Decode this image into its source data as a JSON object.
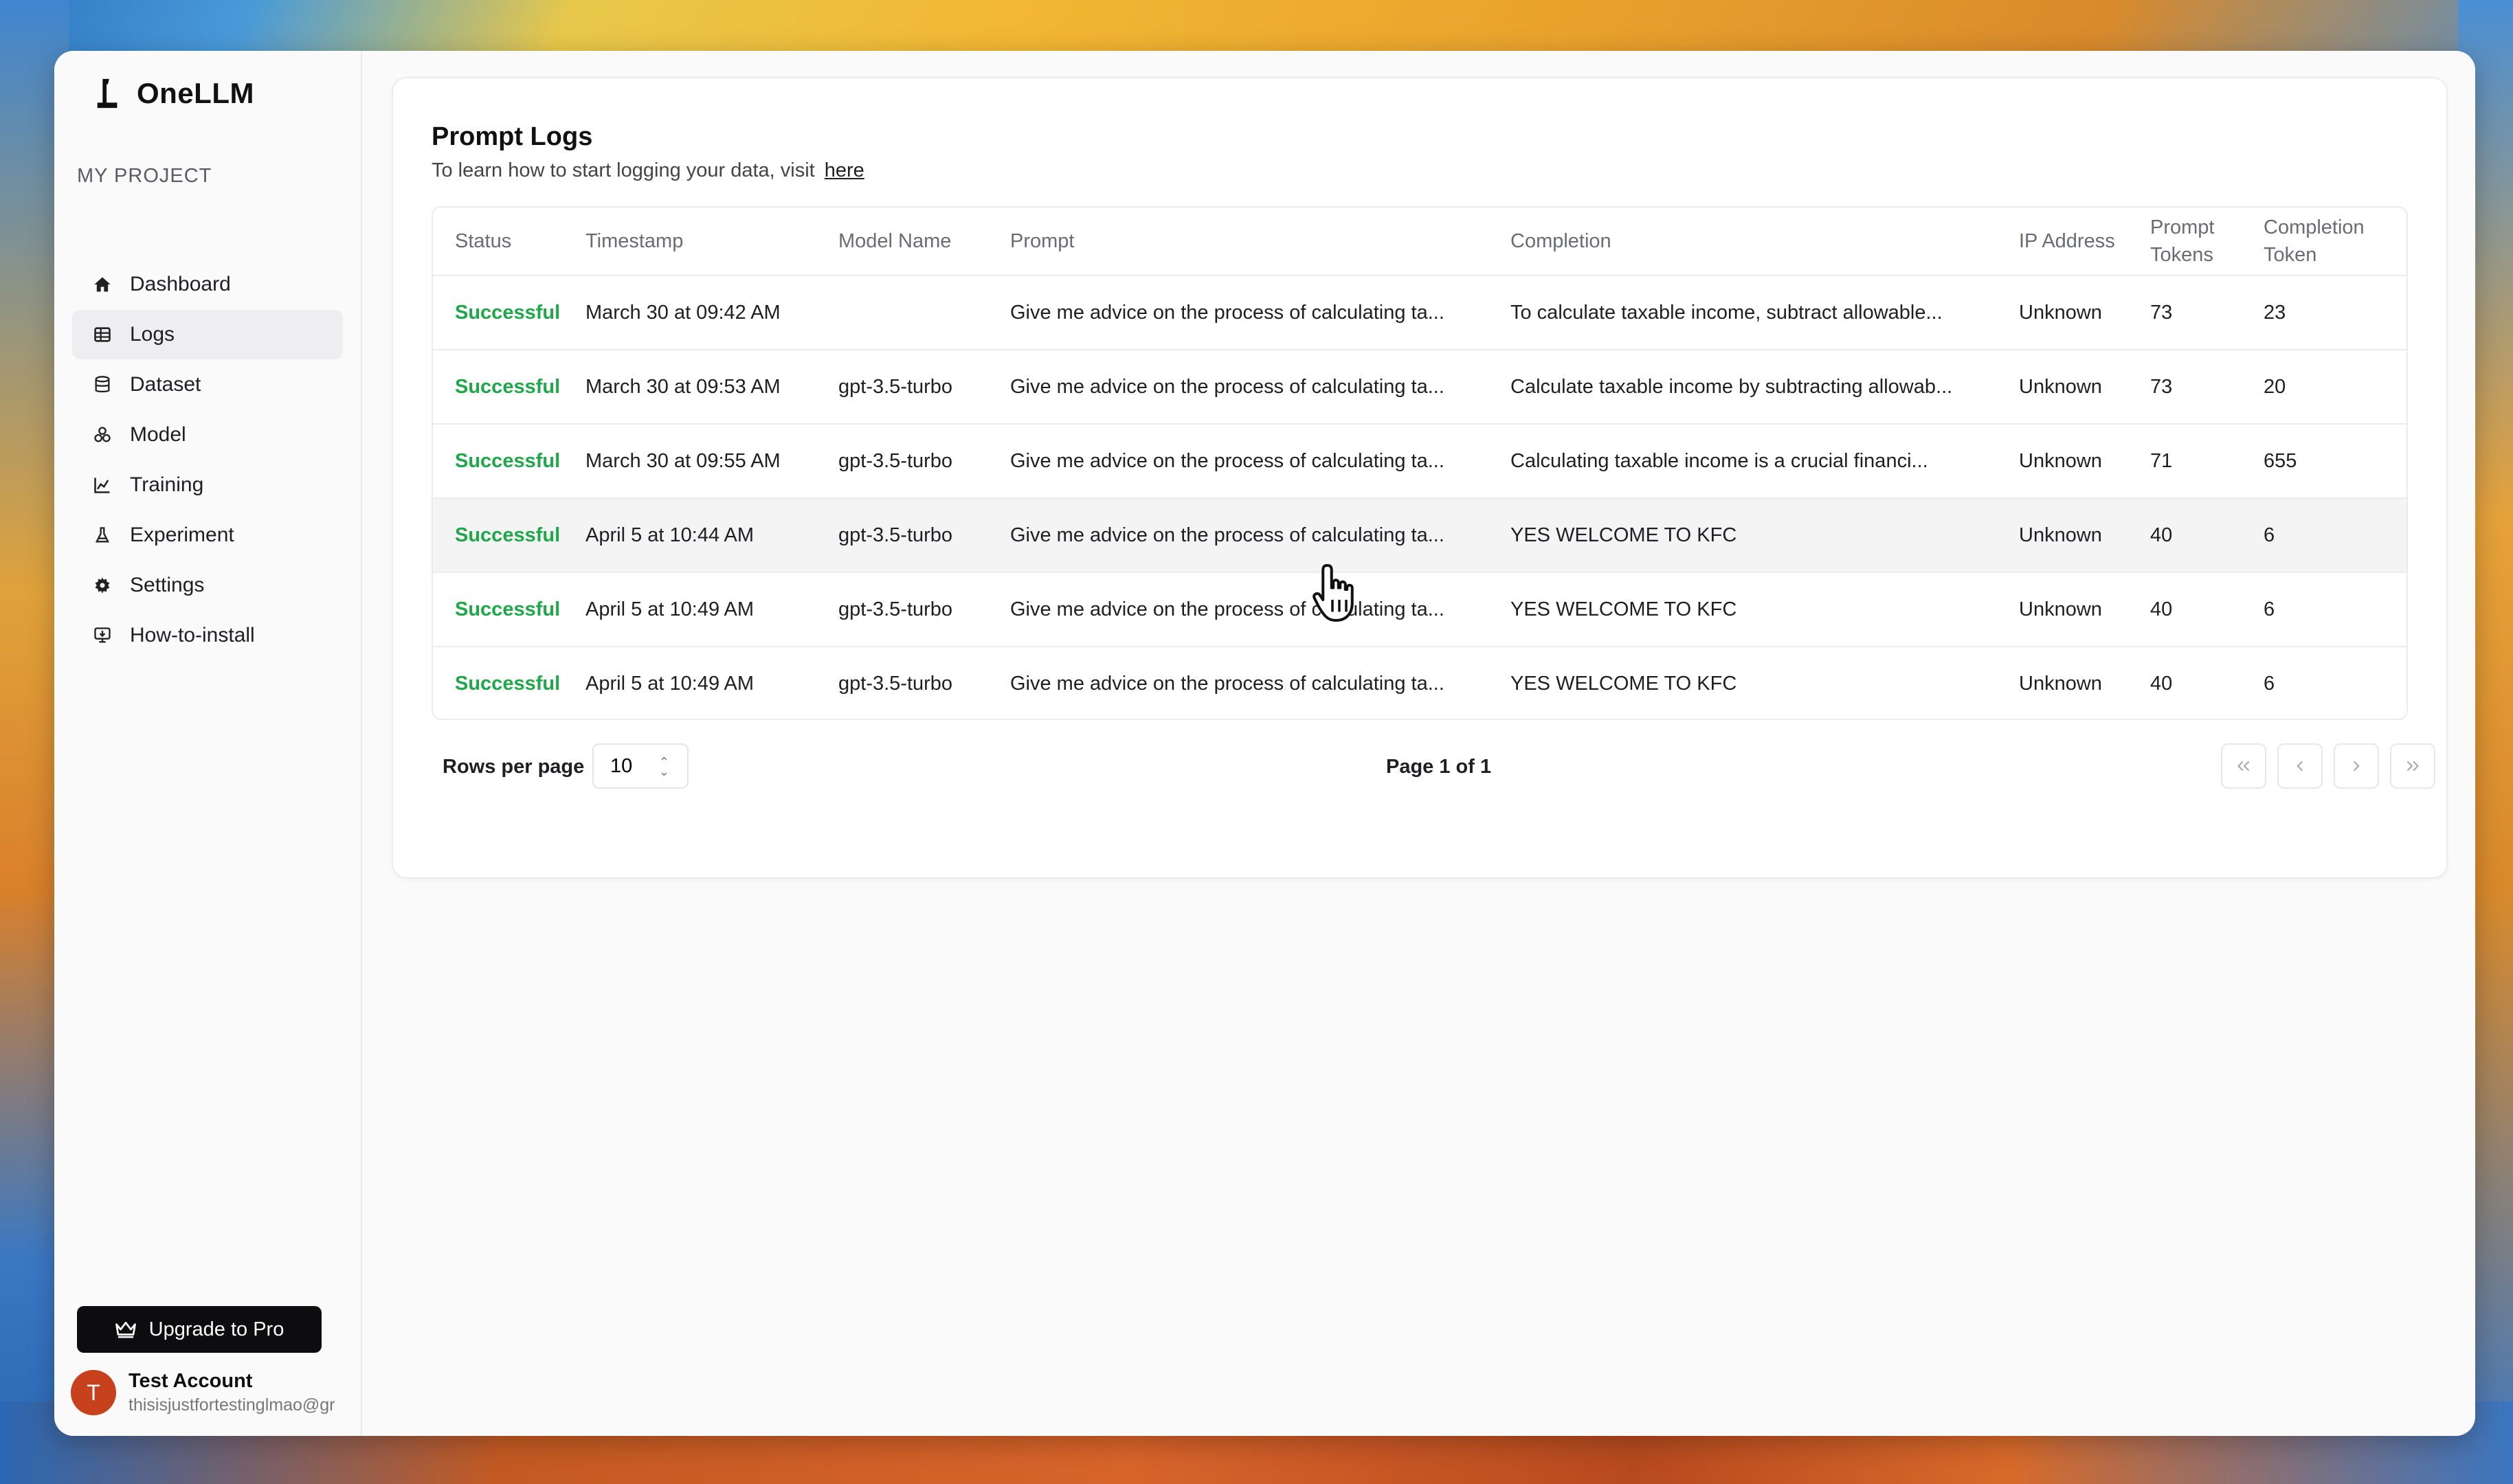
{
  "app": {
    "brand": "OneLLM",
    "section_label": "MY PROJECT"
  },
  "sidebar": {
    "items": [
      {
        "label": "Dashboard",
        "icon": "home-icon"
      },
      {
        "label": "Logs",
        "icon": "table-icon",
        "active": true
      },
      {
        "label": "Dataset",
        "icon": "database-icon"
      },
      {
        "label": "Model",
        "icon": "model-icon"
      },
      {
        "label": "Training",
        "icon": "chart-icon"
      },
      {
        "label": "Experiment",
        "icon": "flask-icon"
      },
      {
        "label": "Settings",
        "icon": "gear-icon"
      },
      {
        "label": "How-to-install",
        "icon": "install-icon"
      }
    ],
    "upgrade_label": "Upgrade to Pro",
    "account": {
      "initial": "T",
      "name": "Test Account",
      "email": "thisisjustfortestinglmao@gr"
    }
  },
  "main": {
    "title": "Prompt Logs",
    "subtitle": "To learn how to start logging your data, visit",
    "link_label": "here",
    "columns": {
      "status": "Status",
      "timestamp": "Timestamp",
      "model": "Model Name",
      "prompt": "Prompt",
      "completion": "Completion",
      "ip": "IP Address",
      "prompt_tokens": "Prompt Tokens",
      "completion_token": "Completion Token"
    },
    "rows": [
      {
        "status": "Successful",
        "timestamp": "March 30 at 09:42 AM",
        "model": "",
        "prompt": "Give me advice on the process of calculating ta...",
        "completion": "To calculate taxable income, subtract allowable...",
        "ip": "Unknown",
        "prompt_tokens": "73",
        "completion_token": "23"
      },
      {
        "status": "Successful",
        "timestamp": "March 30 at 09:53 AM",
        "model": "gpt-3.5-turbo",
        "prompt": "Give me advice on the process of calculating ta...",
        "completion": "Calculate taxable income by subtracting allowab...",
        "ip": "Unknown",
        "prompt_tokens": "73",
        "completion_token": "20"
      },
      {
        "status": "Successful",
        "timestamp": "March 30 at 09:55 AM",
        "model": "gpt-3.5-turbo",
        "prompt": "Give me advice on the process of calculating ta...",
        "completion": "Calculating taxable income is a crucial financi...",
        "ip": "Unknown",
        "prompt_tokens": "71",
        "completion_token": "655"
      },
      {
        "status": "Successful",
        "timestamp": "April 5 at 10:44 AM",
        "model": "gpt-3.5-turbo",
        "prompt": "Give me advice on the process of calculating ta...",
        "completion": "YES WELCOME TO KFC",
        "ip": "Unknown",
        "prompt_tokens": "40",
        "completion_token": "6"
      },
      {
        "status": "Successful",
        "timestamp": "April 5 at 10:49 AM",
        "model": "gpt-3.5-turbo",
        "prompt": "Give me advice on the process of calculating ta...",
        "completion": "YES WELCOME TO KFC",
        "ip": "Unknown",
        "prompt_tokens": "40",
        "completion_token": "6"
      },
      {
        "status": "Successful",
        "timestamp": "April 5 at 10:49 AM",
        "model": "gpt-3.5-turbo",
        "prompt": "Give me advice on the process of calculating ta...",
        "completion": "YES WELCOME TO KFC",
        "ip": "Unknown",
        "prompt_tokens": "40",
        "completion_token": "6"
      }
    ],
    "pagination": {
      "rows_per_page_label": "Rows per page",
      "rows_per_page_value": "10",
      "page_label": "Page 1 of 1"
    }
  },
  "colors": {
    "success": "#1fa74a",
    "avatar": "#c7411c",
    "upgrade_bg": "#0d0d10"
  }
}
